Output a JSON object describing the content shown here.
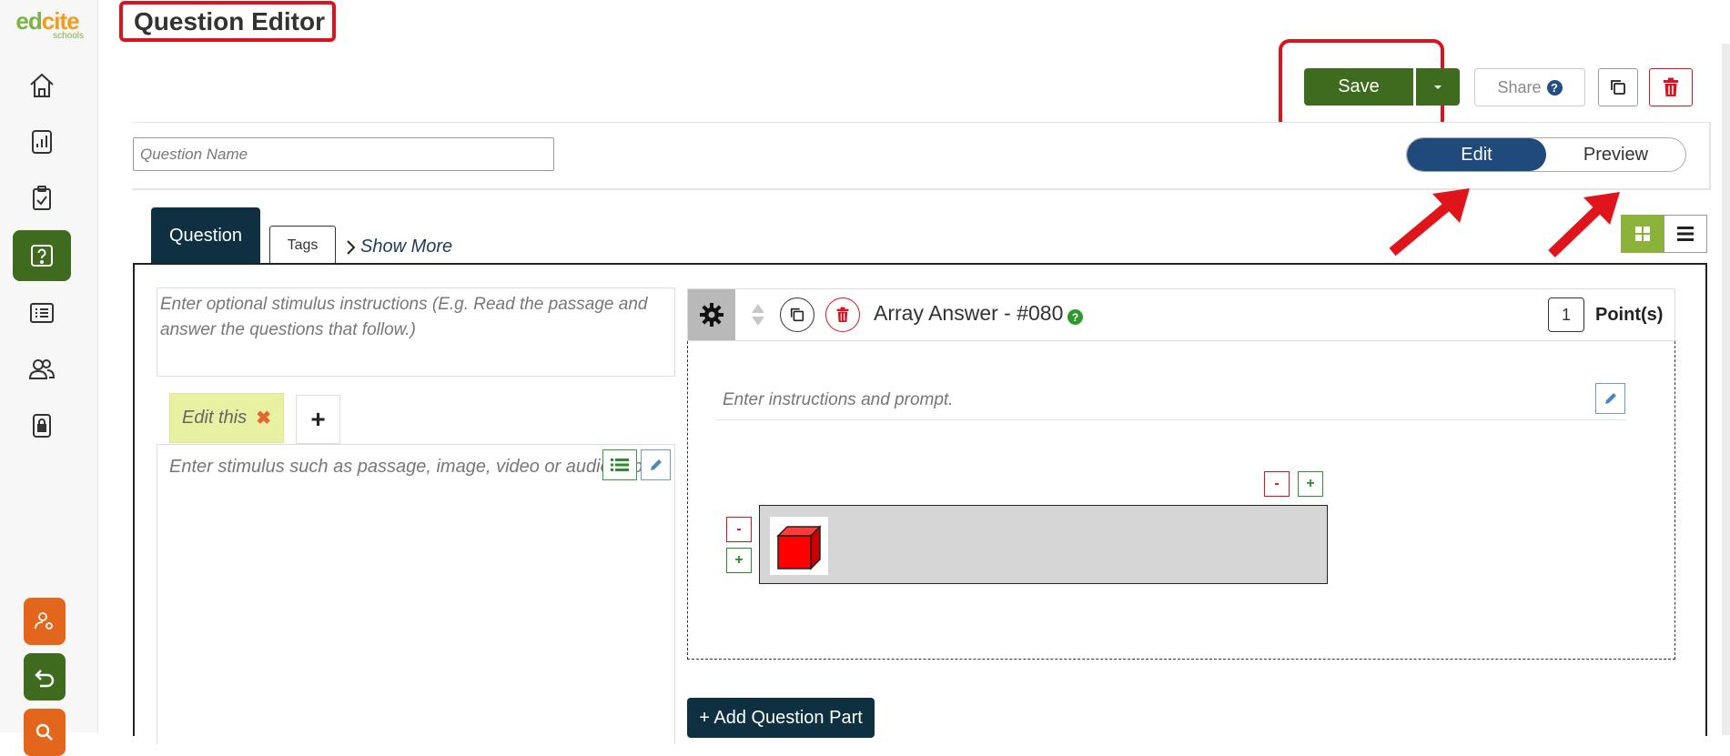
{
  "brand": {
    "logo_word": "edcite",
    "logo_sub": "schools",
    "primary": "#3f6b1e",
    "navy": "#0e3040",
    "highlight": "#d9131f"
  },
  "sidebar": {
    "items": [
      {
        "icon": "home-icon"
      },
      {
        "icon": "reports-icon"
      },
      {
        "icon": "clipboard-icon"
      },
      {
        "icon": "question-icon",
        "active": true
      },
      {
        "icon": "list-icon"
      },
      {
        "icon": "users-icon"
      },
      {
        "icon": "lock-icon"
      }
    ],
    "bottom": [
      {
        "icon": "user-settings-icon",
        "color": "#e2661b"
      },
      {
        "icon": "back-icon",
        "color": "#3f6b1e"
      },
      {
        "icon": "search-icon",
        "color": "#e2661b"
      }
    ]
  },
  "header": {
    "title": "Question Editor",
    "save_label": "Save",
    "share_label": "Share",
    "share_help": "?"
  },
  "name_bar": {
    "placeholder": "Question Name",
    "mode_tabs": {
      "edit": "Edit",
      "preview": "Preview",
      "selected": "Edit"
    }
  },
  "tabs": {
    "question": "Question",
    "tags": "Tags",
    "show_more": "Show More"
  },
  "stimulus": {
    "instructions_placeholder": "Enter optional stimulus instructions (E.g. Read the passage and answer the questions that follow.)",
    "tab_label": "Edit this",
    "tab_close": "✖",
    "add_tab": "+",
    "placeholder": "Enter stimulus such as passage, image, video or audio clip"
  },
  "question_part": {
    "title": "Array Answer - #080",
    "help": "?",
    "points_value": "1",
    "points_label": "Point(s)",
    "prompt_placeholder": "Enter instructions and prompt.",
    "row_minus": "-",
    "row_plus": "+",
    "col_minus": "-",
    "col_plus": "+",
    "array": {
      "rows": 1,
      "columns": 1,
      "cell_item": "red-cube"
    }
  },
  "add_part_label": "+ Add Question Part"
}
